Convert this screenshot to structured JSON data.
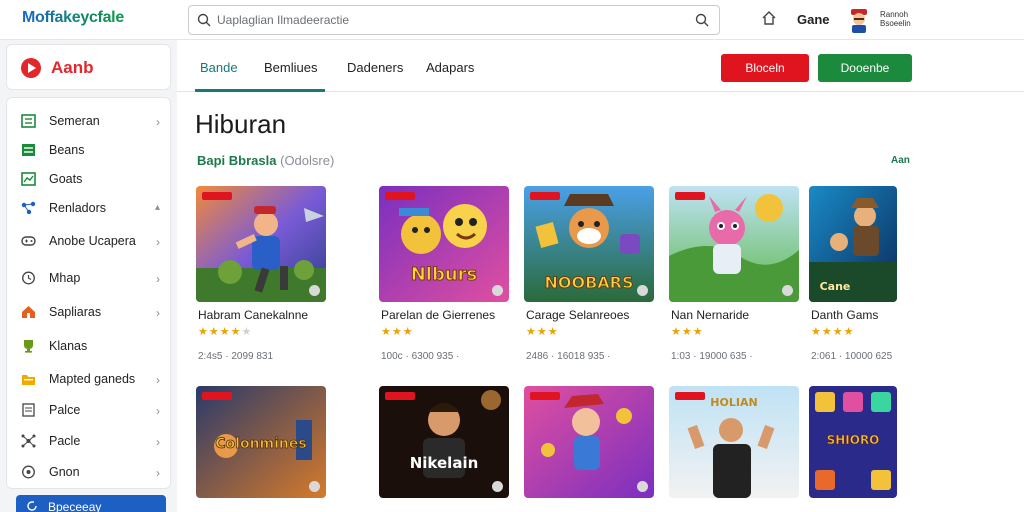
{
  "app": {
    "logo": "Moffakeycfale",
    "search_placeholder": "Uaplaglian Ilmadeeractie",
    "game_link": "Gane",
    "user_name_line1": "Rannoh",
    "user_name_line2": "Bsoeelin"
  },
  "brand": {
    "name": "Aanb"
  },
  "sidebar": {
    "items": [
      {
        "label": "Semeran",
        "icon": "grid-icon"
      },
      {
        "label": "Beans",
        "icon": "list-icon"
      },
      {
        "label": "Goats",
        "icon": "chart-icon"
      },
      {
        "label": "Renladors",
        "icon": "share-icon"
      },
      {
        "label": "Anobe Ucapera",
        "icon": "gamepad-icon"
      },
      {
        "label": "Mhap",
        "icon": "clock-icon"
      },
      {
        "label": "Sapliaras",
        "icon": "home-icon"
      },
      {
        "label": "Klanas",
        "icon": "trophy-icon"
      },
      {
        "label": "Mapted ganeds",
        "icon": "folder-icon"
      },
      {
        "label": "Palce",
        "icon": "page-icon"
      },
      {
        "label": "Pacle",
        "icon": "network-icon"
      },
      {
        "label": "Gnon",
        "icon": "settings-icon"
      }
    ],
    "cta_label": "Bpeceeay"
  },
  "tabs": [
    {
      "label": "Bande",
      "active": true
    },
    {
      "label": "Bemliues",
      "active": false
    },
    {
      "label": "Dadeners",
      "active": false
    },
    {
      "label": "Adapars",
      "active": false
    }
  ],
  "buttons": {
    "red": "Bloceln",
    "green": "Dooenbe"
  },
  "page_title": "Hiburan",
  "section": {
    "title": "Bapi Bbrasla",
    "note": "(Odolsre)",
    "see_all": "Aan"
  },
  "games_row1": [
    {
      "title": "Habram Canekalnne",
      "rating": 4,
      "meta": "2:4s5 · 2099 831",
      "art_text": ""
    },
    {
      "title": "Parelan de Gierrenes",
      "rating": 3,
      "meta": "100c · 6300 935 ·",
      "art_text": "Nlburs"
    },
    {
      "title": "Carage Selanreoes",
      "rating": 3,
      "meta": "2486 · 16018 935 ·",
      "art_text": "NOOBARS"
    },
    {
      "title": "Nan Nernaride",
      "rating": 3,
      "meta": "1:03 · 19000 635 ·",
      "art_text": ""
    },
    {
      "title": "Danth Gams",
      "rating": 4,
      "meta": "2:061 · 10000 625",
      "art_text": "Cane"
    }
  ],
  "games_row2": [
    {
      "art_text": "Colonmines"
    },
    {
      "art_text": "Nikelain"
    },
    {
      "art_text": ""
    },
    {
      "art_text": "HOLIAN"
    },
    {
      "art_text": "SHIORO"
    }
  ],
  "colors": {
    "accent": "#157a7a",
    "red": "#e0141e",
    "green": "#1c8a3d",
    "stars": "#e8a400"
  }
}
